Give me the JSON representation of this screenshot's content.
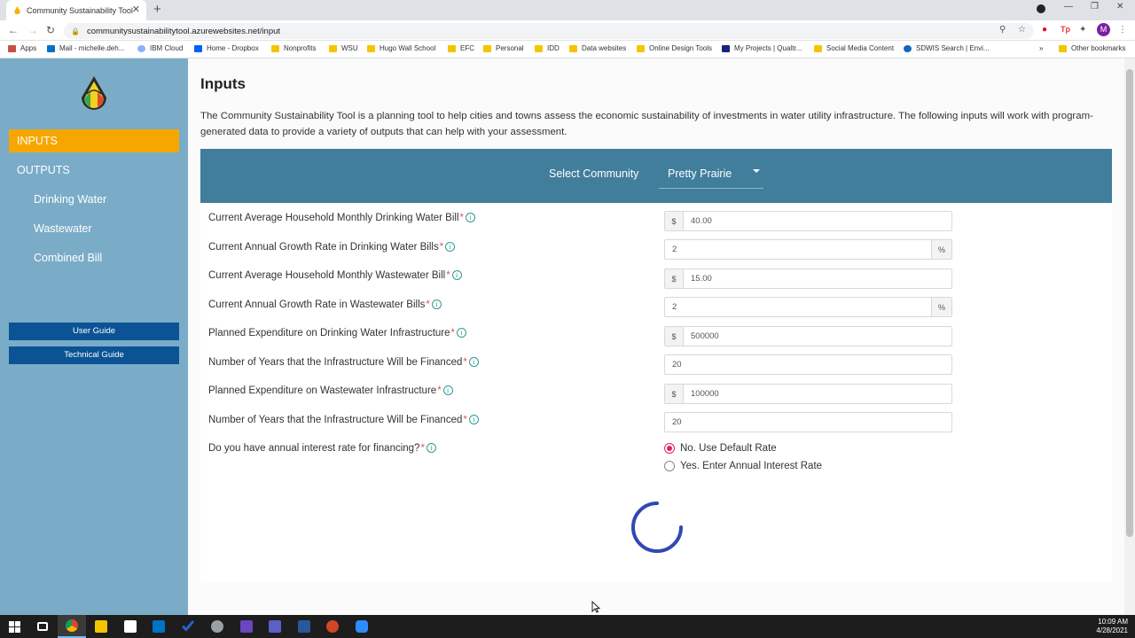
{
  "browser": {
    "tab_title": "Community Sustainability Tool",
    "tab_close": "✕",
    "new_tab": "+",
    "url": "communitysustainabilitytool.azurewebsites.net/input",
    "profile_initial": "M",
    "bookmarks": [
      "Apps",
      "Mail - michelle.deh...",
      "IBM Cloud",
      "Home - Dropbox",
      "Nonprofits",
      "WSU",
      "Hugo Wall School",
      "EFC",
      "Personal",
      "IDD",
      "Data websites",
      "Online Design Tools",
      "My Projects | Qualtr...",
      "Social Media Content",
      "SDWIS Search | Envi..."
    ],
    "bookmarks_more": "»",
    "other_bookmarks": "Other bookmarks"
  },
  "sidebar": {
    "active_item": "INPUTS",
    "items": [
      "OUTPUTS",
      "Drinking Water",
      "Wastewater",
      "Combined Bill"
    ],
    "buttons": [
      "User Guide",
      "Technical Guide"
    ]
  },
  "main": {
    "title": "Inputs",
    "intro": "The Community Sustainability Tool is a planning tool to help cities and towns assess the economic sustainability of investments in water utility infrastructure. The following inputs will work with program-generated data to provide a variety of outputs that can help with your assessment.",
    "select_label": "Select Community",
    "community": "Pretty Prairie",
    "required_mark": "*",
    "info_glyph": "i",
    "fields": [
      {
        "label": "Current Average Household Monthly Drinking Water Bill",
        "prefix": "$",
        "value": "40.00",
        "suffix": ""
      },
      {
        "label": "Current Annual Growth Rate in Drinking Water Bills",
        "prefix": "",
        "value": "2",
        "suffix": "%"
      },
      {
        "label": "Current Average Household Monthly Wastewater Bill",
        "prefix": "$",
        "value": "15.00",
        "suffix": ""
      },
      {
        "label": "Current Annual Growth Rate in Wastewater Bills",
        "prefix": "",
        "value": "2",
        "suffix": "%"
      },
      {
        "label": "Planned Expenditure on Drinking Water Infrastructure",
        "prefix": "$",
        "value": "500000",
        "suffix": ""
      },
      {
        "label": "Number of Years that the Infrastructure Will be Financed",
        "prefix": "",
        "value": "20",
        "suffix": ""
      },
      {
        "label": "Planned Expenditure on Wastewater Infrastructure",
        "prefix": "$",
        "value": "100000",
        "suffix": ""
      },
      {
        "label": "Number of Years that the Infrastructure Will be Financed",
        "prefix": "",
        "value": "20",
        "suffix": ""
      }
    ],
    "interest_question": "Do you have annual interest rate for financing?",
    "radio_options": [
      "No. Use Default Rate",
      "Yes. Enter Annual Interest Rate"
    ],
    "radio_selected": 0
  },
  "taskbar": {
    "time": "10:09 AM",
    "date": "4/28/2021"
  },
  "colors": {
    "sidebar": "#7aacc8",
    "active_nav": "#f7a600",
    "band": "#407e9c",
    "guide_button": "#0b5394",
    "radio_selected": "#e91e63"
  }
}
